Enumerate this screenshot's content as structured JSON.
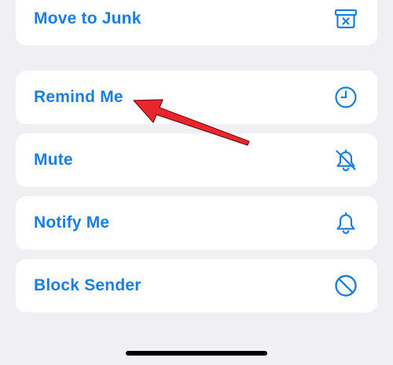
{
  "actions": [
    {
      "label": "Move to Junk",
      "icon": "junk-bin-icon"
    },
    {
      "label": "Remind Me",
      "icon": "clock-icon"
    },
    {
      "label": "Mute",
      "icon": "bell-slash-icon"
    },
    {
      "label": "Notify Me",
      "icon": "bell-icon"
    },
    {
      "label": "Block Sender",
      "icon": "block-icon"
    }
  ],
  "colors": {
    "accent": "#1a7ee0",
    "background": "#efeff4",
    "card": "#ffffff",
    "annotation_arrow": "#e8262b"
  }
}
